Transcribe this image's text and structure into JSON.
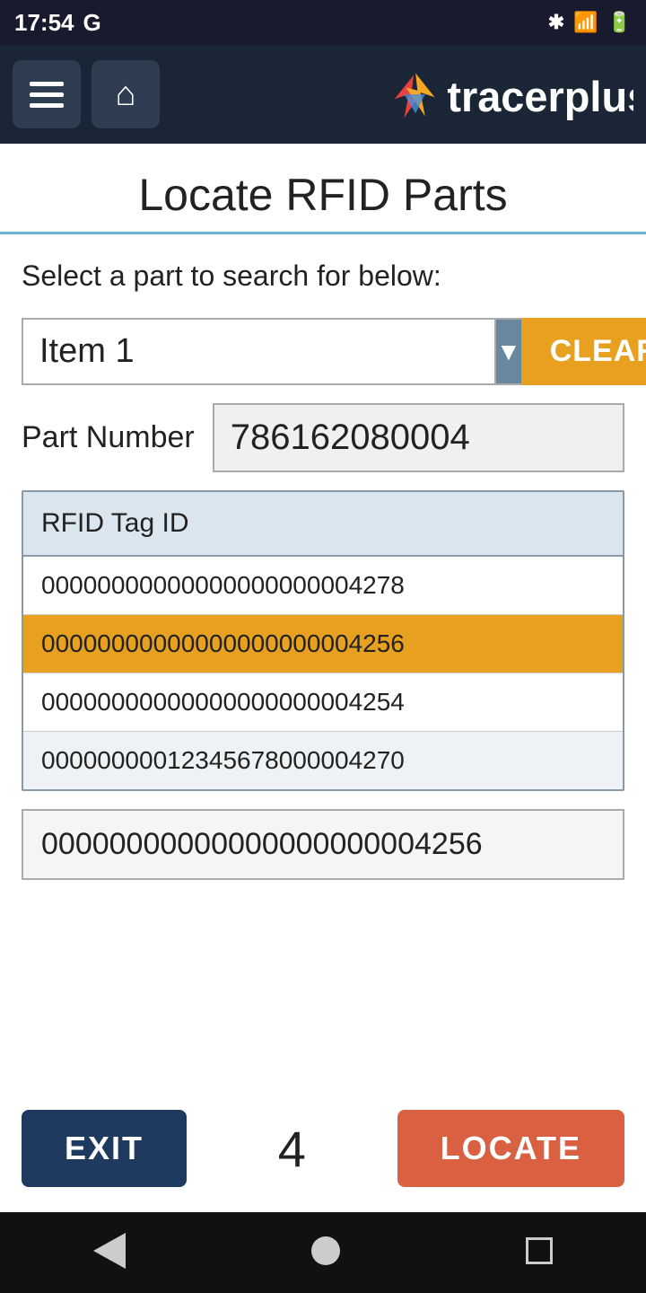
{
  "statusBar": {
    "time": "17:54",
    "carrier": "G"
  },
  "appBar": {
    "menuIcon": "menu-icon",
    "homeIcon": "home-icon",
    "logoText": "tracerplus"
  },
  "pageTitle": "Locate RFID Parts",
  "searchSection": {
    "label": "Select a part to search for below:",
    "selectedItem": "Item 1",
    "dropdownArrow": "▼",
    "clearLabel": "CLEAR"
  },
  "partNumber": {
    "label": "Part Number",
    "value": "786162080004"
  },
  "rfidTable": {
    "header": "RFID Tag ID",
    "rows": [
      {
        "id": "00000000000000000000004278",
        "highlighted": false,
        "alt": false
      },
      {
        "id": "00000000000000000000004256",
        "highlighted": true,
        "alt": false
      },
      {
        "id": "00000000000000000000004254",
        "highlighted": false,
        "alt": false
      },
      {
        "id": "000000000123456780000 04270",
        "highlighted": false,
        "alt": true
      }
    ]
  },
  "selectedTag": "00000000000000000000004256",
  "actionBar": {
    "exitLabel": "EXIT",
    "count": "4",
    "locateLabel": "LOCATE"
  }
}
